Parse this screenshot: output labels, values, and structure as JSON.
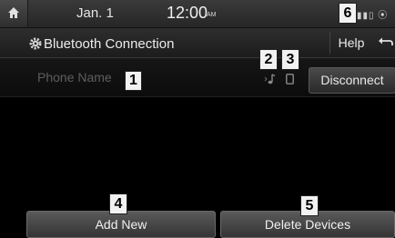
{
  "status_bar": {
    "home_icon": "home-icon",
    "date": "Jan.  1",
    "time": "12:00",
    "ampm": "AM",
    "status_icons": "signal-bluetooth-icons"
  },
  "header": {
    "title": "Bluetooth Connection",
    "title_icon": "gear-icon",
    "help_label": "Help",
    "back_icon": "back-arrow-icon"
  },
  "device": {
    "phone_name": "Phone Name",
    "audio_icon": "bluetooth-audio-icon",
    "phone_icon": "handsfree-phone-icon",
    "disconnect_label": "Disconnect"
  },
  "footer": {
    "add_new_label": "Add New",
    "delete_devices_label": "Delete Devices"
  },
  "callouts": [
    "1",
    "2",
    "3",
    "4",
    "5",
    "6"
  ],
  "colors": {
    "background": "#000000",
    "text": "#e8e8e8",
    "dim_text": "#5e5e5e",
    "button": "#4a4a4a"
  }
}
